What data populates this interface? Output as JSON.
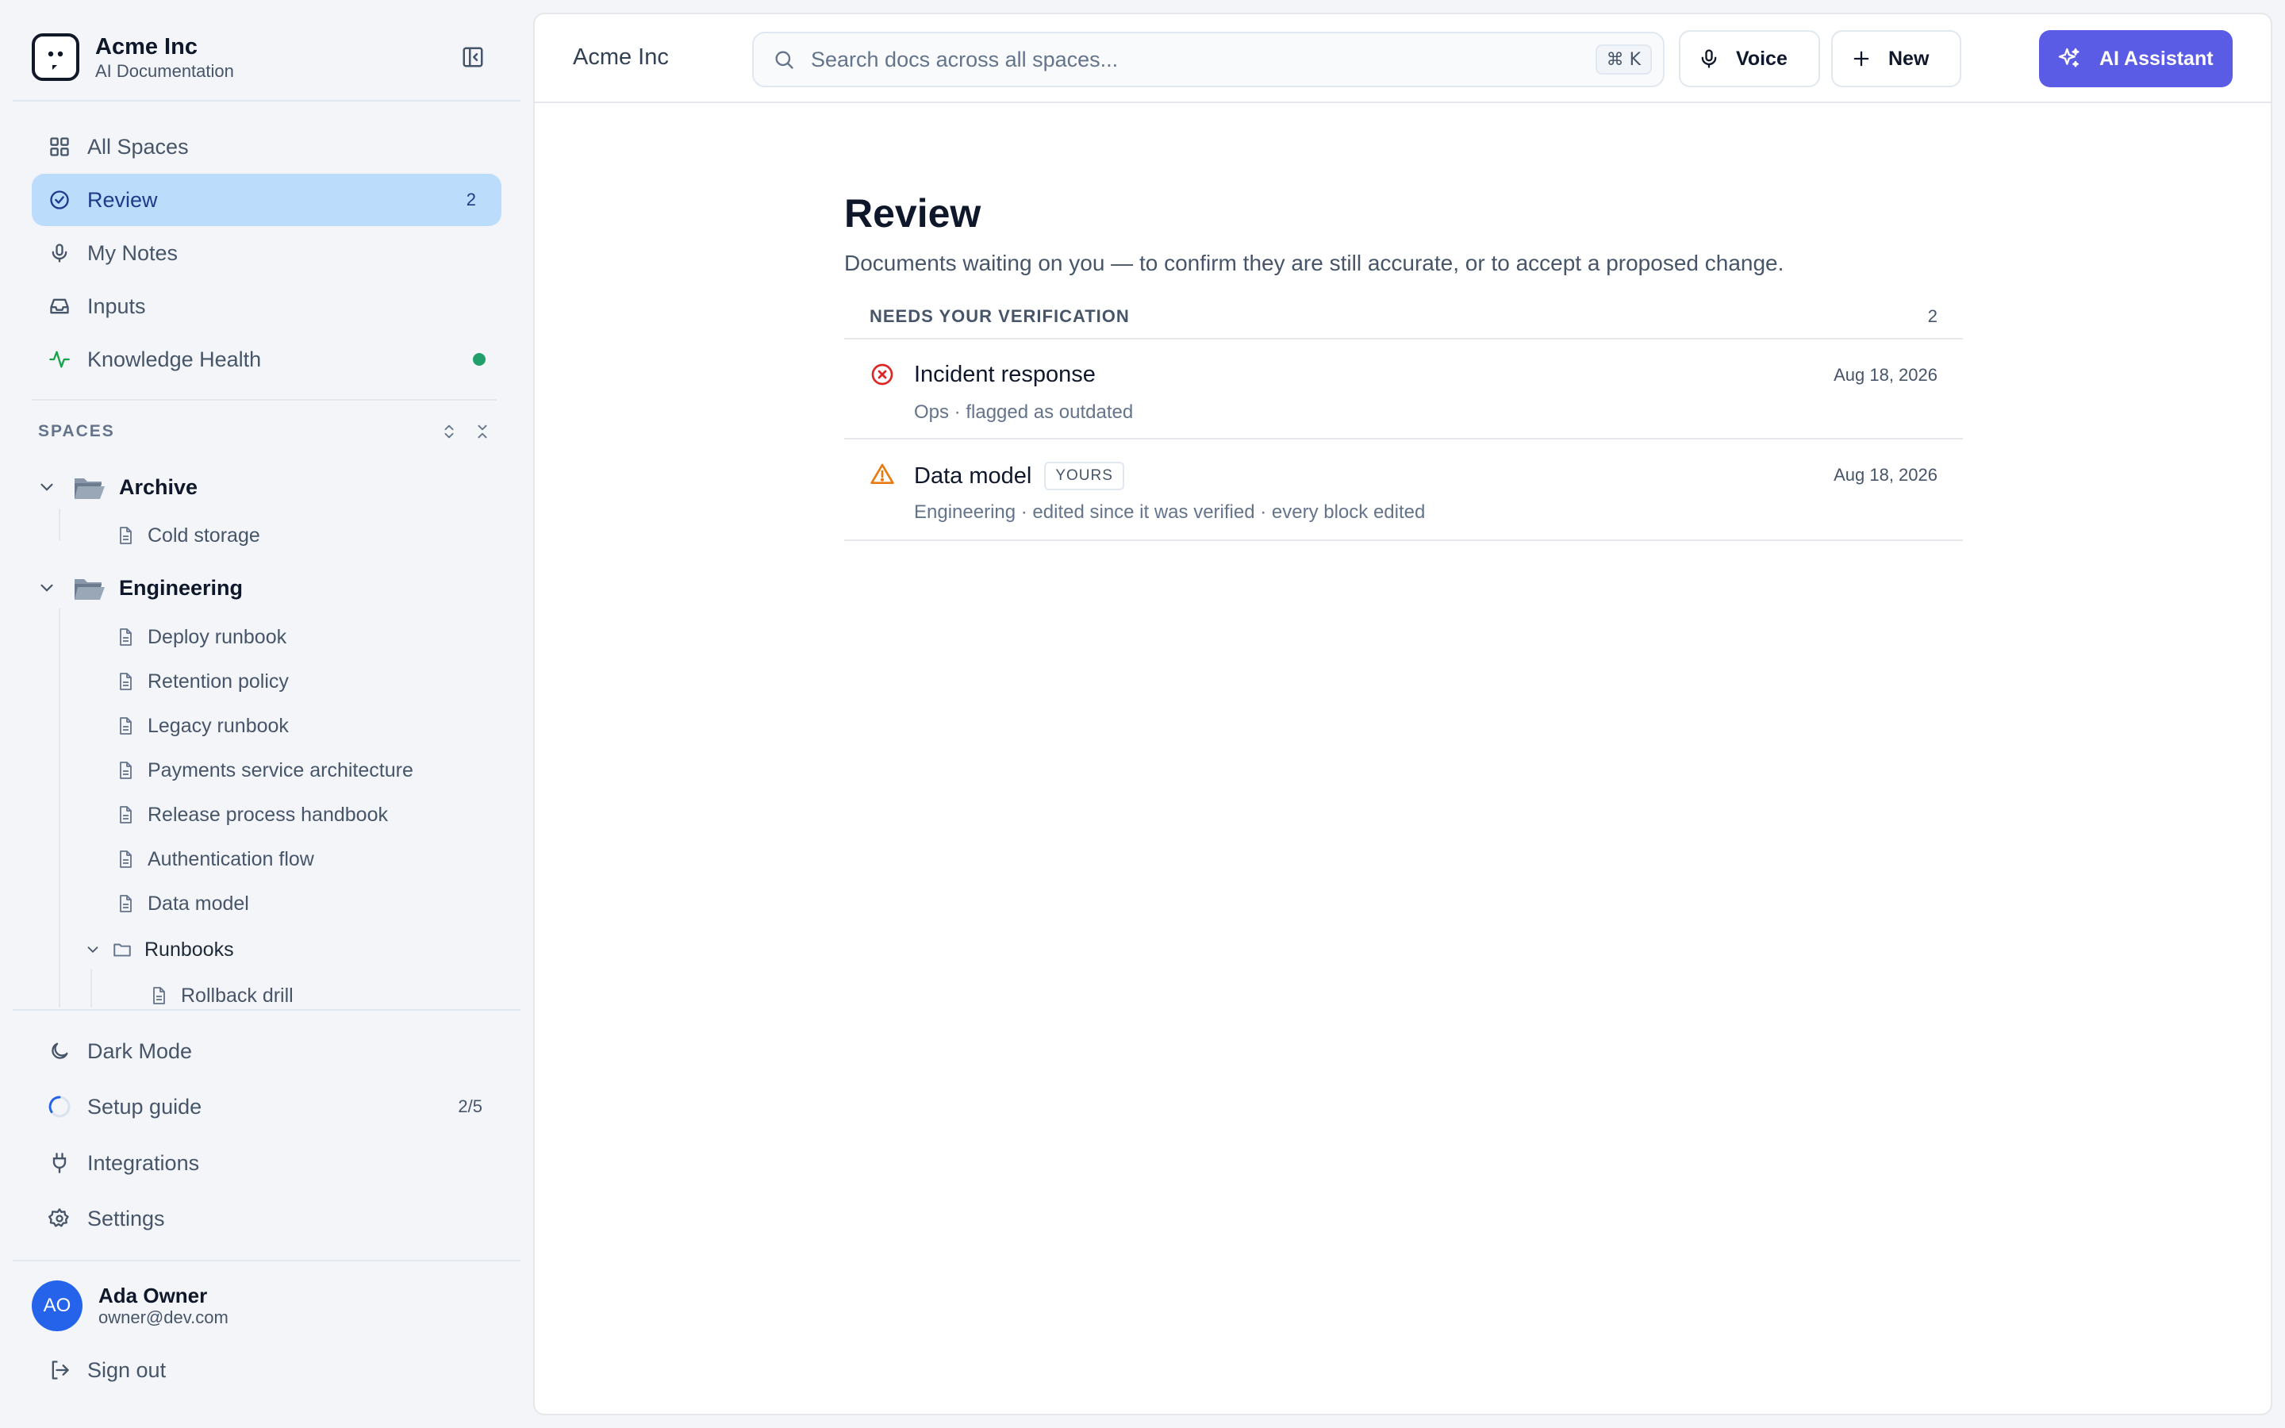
{
  "brand": {
    "name": "Acme Inc",
    "subtitle": "AI Documentation"
  },
  "nav": {
    "items": [
      {
        "label": "All Spaces",
        "icon": "grid-icon"
      },
      {
        "label": "Review",
        "icon": "check-circle-icon",
        "count": "2",
        "active": true
      },
      {
        "label": "My Notes",
        "icon": "microphone-icon"
      },
      {
        "label": "Inputs",
        "icon": "inbox-icon"
      },
      {
        "label": "Knowledge Health",
        "icon": "activity-icon",
        "status_color": "#22a06b"
      }
    ]
  },
  "spaces": {
    "heading": "SPACES",
    "folders": [
      {
        "name": "Archive",
        "docs": [
          "Cold storage"
        ]
      },
      {
        "name": "Engineering",
        "docs": [
          "Deploy runbook",
          "Retention policy",
          "Legacy runbook",
          "Payments service architecture",
          "Release process handbook",
          "Authentication flow",
          "Data model"
        ],
        "subfolders": [
          {
            "name": "Runbooks",
            "docs": [
              "Rollback drill"
            ]
          }
        ]
      }
    ]
  },
  "bottom_nav": {
    "dark_mode": "Dark Mode",
    "setup_guide": "Setup guide",
    "setup_progress": "2/5",
    "integrations": "Integrations",
    "settings": "Settings"
  },
  "user": {
    "initials": "AO",
    "name": "Ada Owner",
    "email": "owner@dev.com",
    "sign_out": "Sign out"
  },
  "topbar": {
    "breadcrumb": "Acme Inc",
    "search_placeholder": "Search docs across all spaces...",
    "shortcut": "⌘ K",
    "voice_label": "Voice",
    "new_label": "New",
    "ai_label": "AI Assistant"
  },
  "page": {
    "title": "Review",
    "subtitle": "Documents waiting on you — to confirm they are still accurate, or to accept a proposed change.",
    "section_title": "NEEDS YOUR VERIFICATION",
    "section_count": "2",
    "rows": [
      {
        "title": "Incident response",
        "meta": "Ops · flagged as outdated",
        "date": "Aug 18, 2026",
        "status": "outdated",
        "icon": "x-circle-icon"
      },
      {
        "title": "Data model",
        "badge": "YOURS",
        "meta": "Engineering · edited since it was verified · every block edited",
        "date": "Aug 18, 2026",
        "status": "changed",
        "icon": "warning-icon"
      }
    ]
  },
  "colors": {
    "accent": "#5b5ce6",
    "active_nav": "#bcdcfb",
    "error": "#dc2626",
    "warning": "#ea7a0c",
    "health": "#22a06b"
  }
}
